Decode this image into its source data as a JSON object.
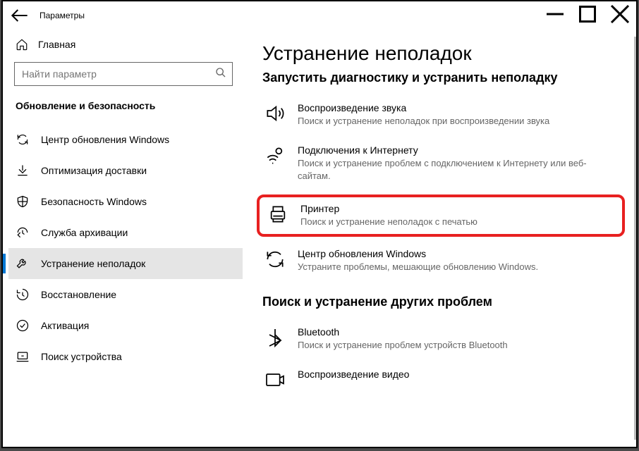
{
  "window": {
    "title": "Параметры"
  },
  "sidebar": {
    "home_label": "Главная",
    "search_placeholder": "Найти параметр",
    "section_header": "Обновление и безопасность",
    "items": [
      {
        "label": "Центр обновления Windows",
        "icon": "update-sync-icon"
      },
      {
        "label": "Оптимизация доставки",
        "icon": "delivery-opt-icon"
      },
      {
        "label": "Безопасность Windows",
        "icon": "shield-icon"
      },
      {
        "label": "Служба архивации",
        "icon": "backup-icon"
      },
      {
        "label": "Устранение неполадок",
        "icon": "troubleshoot-icon"
      },
      {
        "label": "Восстановление",
        "icon": "recovery-icon"
      },
      {
        "label": "Активация",
        "icon": "activation-icon"
      },
      {
        "label": "Поиск устройства",
        "icon": "find-device-icon"
      }
    ]
  },
  "main": {
    "title": "Устранение неполадок",
    "subtitle": "Запустить диагностику и устранить неполадку",
    "items": [
      {
        "title": "Воспроизведение звука",
        "desc": "Поиск и устранение неполадок при воспроизведении звука"
      },
      {
        "title": "Подключения к Интернету",
        "desc": "Поиск и устранение проблем с подключением к Интернету или веб-сайтам."
      },
      {
        "title": "Принтер",
        "desc": "Поиск и устранение неполадок с печатью"
      },
      {
        "title": "Центр обновления Windows",
        "desc": "Устраните проблемы, мешающие обновлению Windows."
      }
    ],
    "other_heading": "Поиск и устранение других проблем",
    "other_items": [
      {
        "title": "Bluetooth",
        "desc": "Поиск и устранение проблем устройств Bluetooth"
      },
      {
        "title": "Воспроизведение видео",
        "desc": ""
      }
    ]
  }
}
